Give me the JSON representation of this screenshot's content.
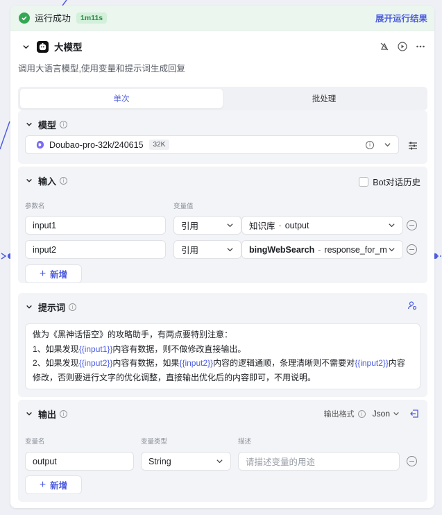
{
  "status": {
    "label": "运行成功",
    "duration": "1m11s",
    "expand_label": "展开运行结果"
  },
  "node": {
    "title": "大模型",
    "description": "调用大语言模型,使用变量和提示词生成回复"
  },
  "tabs": [
    {
      "label": "单次",
      "active": true
    },
    {
      "label": "批处理",
      "active": false
    }
  ],
  "model": {
    "section_label": "模型",
    "name": "Doubao-pro-32k/240615",
    "context_badge": "32K"
  },
  "input": {
    "section_label": "输入",
    "bot_history_label": "Bot对话历史",
    "col_param": "参数名",
    "col_value": "变量值",
    "rows": [
      {
        "name": "input1",
        "mode": "引用",
        "source": "知识库",
        "field": "output"
      },
      {
        "name": "input2",
        "mode": "引用",
        "source": "bingWebSearch",
        "field": "response_for_m"
      }
    ],
    "add_label": "新增"
  },
  "prompt": {
    "section_label": "提示词",
    "line1": "做为《黑神话悟空》的攻略助手，有两点要特别注意：",
    "line2_a": "1、如果发现",
    "line2_var": "{{input1}}",
    "line2_b": "内容有数据，则不做修改直接输出。",
    "line3_a": "2、如果发现",
    "line3_var": "{{input2}}",
    "line3_b": "内容有数据，如果",
    "line3_var2": "{{input2}}",
    "line3_c": "内容的逻辑通顺，条理清晰则不需要对",
    "line3_var3": "{{input2}}",
    "line3_d": "内容",
    "line4": "修改，否则要进行文字的优化调整，直接输出优化后的内容即可，不用说明。"
  },
  "output": {
    "section_label": "输出",
    "format_label": "输出格式",
    "format_value": "Json",
    "col_name": "变量名",
    "col_type": "变量类型",
    "col_desc": "描述",
    "rows": [
      {
        "name": "output",
        "type": "String",
        "desc_placeholder": "请描述变量的用途"
      }
    ],
    "add_label": "新增"
  },
  "colors": {
    "accent": "#4e5dde",
    "success": "#32a852"
  }
}
